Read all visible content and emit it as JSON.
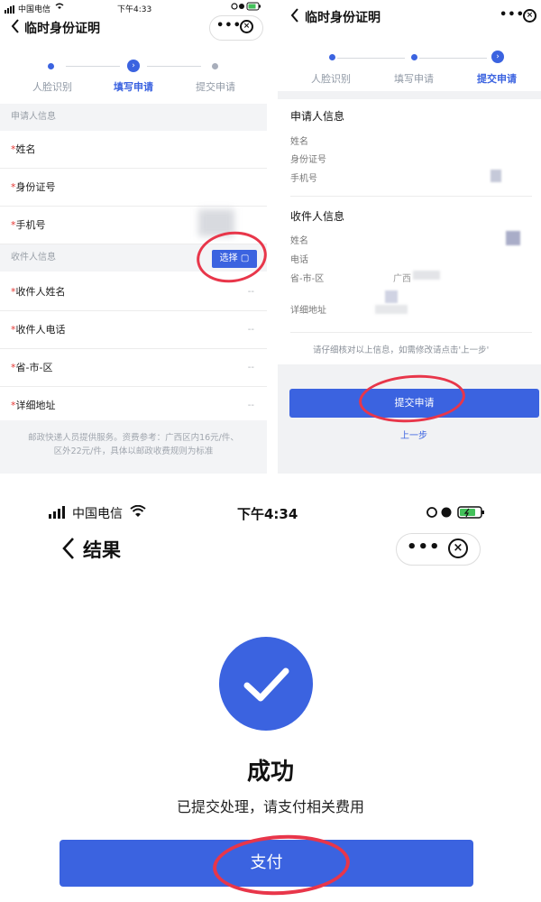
{
  "screen1": {
    "status": {
      "carrier": "中国电信",
      "time": "下午4:33"
    },
    "nav_title": "临时身份证明",
    "steps": [
      "人脸识别",
      "填写申请",
      "提交申请"
    ],
    "applicant_header": "申请人信息",
    "fields": {
      "name": "姓名",
      "id": "身份证号",
      "phone": "手机号"
    },
    "recipient_header": "收件人信息",
    "select_label": "选择",
    "recipient_fields": {
      "name": "收件人姓名",
      "phone": "收件人电话",
      "region": "省-市-区",
      "address": "详细地址"
    },
    "placeholder": "--",
    "required_mark": "*",
    "footnote_line1": "邮政快递人员提供服务。资费参考：广西区内16元/件、",
    "footnote_line2": "区外22元/件，具体以邮政收费规则为标准"
  },
  "screen2": {
    "nav_title": "临时身份证明",
    "steps": [
      "人脸识别",
      "填写申请",
      "提交申请"
    ],
    "applicant_title": "申请人信息",
    "applicant_fields": {
      "name": "姓名",
      "id": "身份证号",
      "phone": "手机号"
    },
    "recipient_title": "收件人信息",
    "recipient_fields": {
      "name": "姓名",
      "phone": "电话",
      "region": "省-市-区",
      "address": "详细地址"
    },
    "region_value": "广西",
    "hint": "请仔细核对以上信息，如需修改请点击'上一步'",
    "submit_label": "提交申请",
    "prev_label": "上一步"
  },
  "screen3": {
    "status": {
      "carrier": "中国电信",
      "time": "下午4:34"
    },
    "nav_title": "结果",
    "result_title": "成功",
    "result_subtitle": "已提交处理，请支付相关费用",
    "pay_label": "支付"
  },
  "colors": {
    "accent": "#3b63e0",
    "annotation": "#e8364a",
    "required": "#e53935"
  }
}
